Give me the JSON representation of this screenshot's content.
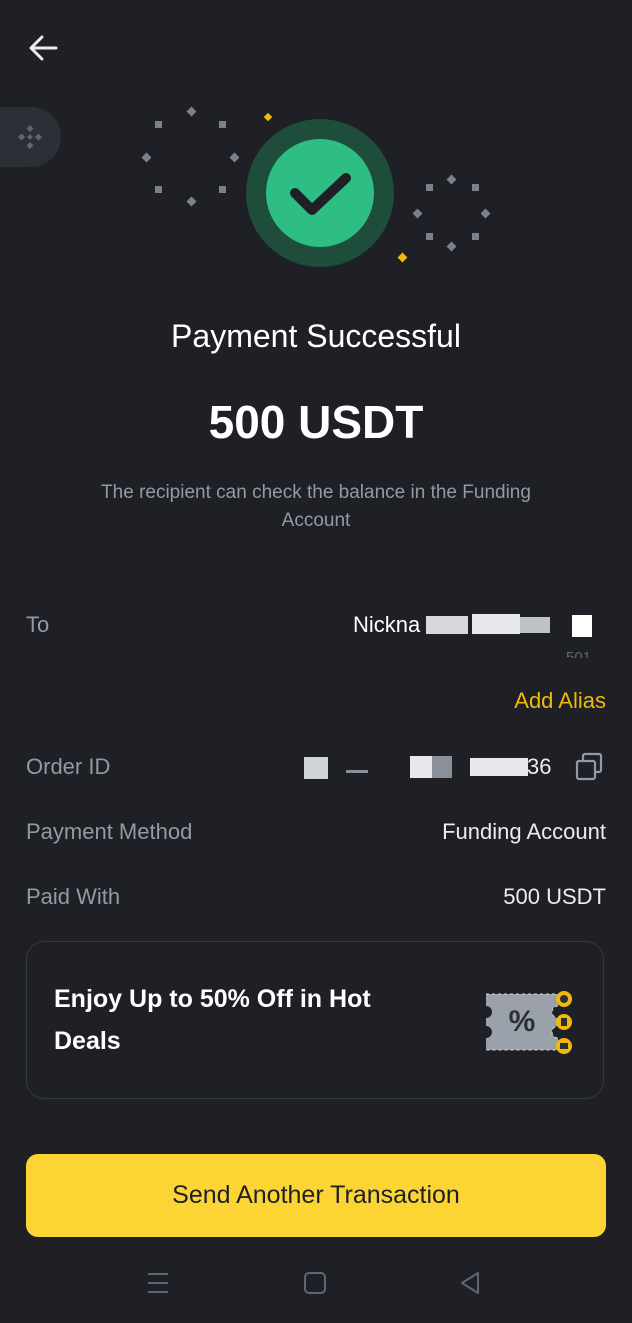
{
  "header": {
    "back_icon": "arrow-left-icon",
    "side_tab_icon": "binance-logo-icon"
  },
  "status": {
    "title": "Payment Successful",
    "amount": "500 USDT",
    "note": "The recipient can check the balance in the Funding Account",
    "icon": "check-circle-icon"
  },
  "details": {
    "to_label": "To",
    "to_value_visible": "Nickna",
    "to_sub_visible": "501",
    "add_alias": "Add Alias",
    "order_id_label": "Order ID",
    "order_id_visible": "36",
    "payment_method_label": "Payment Method",
    "payment_method_value": "Funding Account",
    "paid_with_label": "Paid With",
    "paid_with_value": "500 USDT"
  },
  "promo": {
    "text": "Enjoy Up to 50% Off in Hot Deals",
    "icon": "coupon-icon"
  },
  "cta": {
    "label": "Send Another Transaction"
  },
  "system_nav": {
    "menu_icon": "menu-icon",
    "home_icon": "home-square-icon",
    "back_icon": "back-triangle-icon"
  },
  "colors": {
    "background": "#1e2026",
    "accent": "#fcd535",
    "link": "#f0b90b",
    "success": "#2ebd85"
  }
}
